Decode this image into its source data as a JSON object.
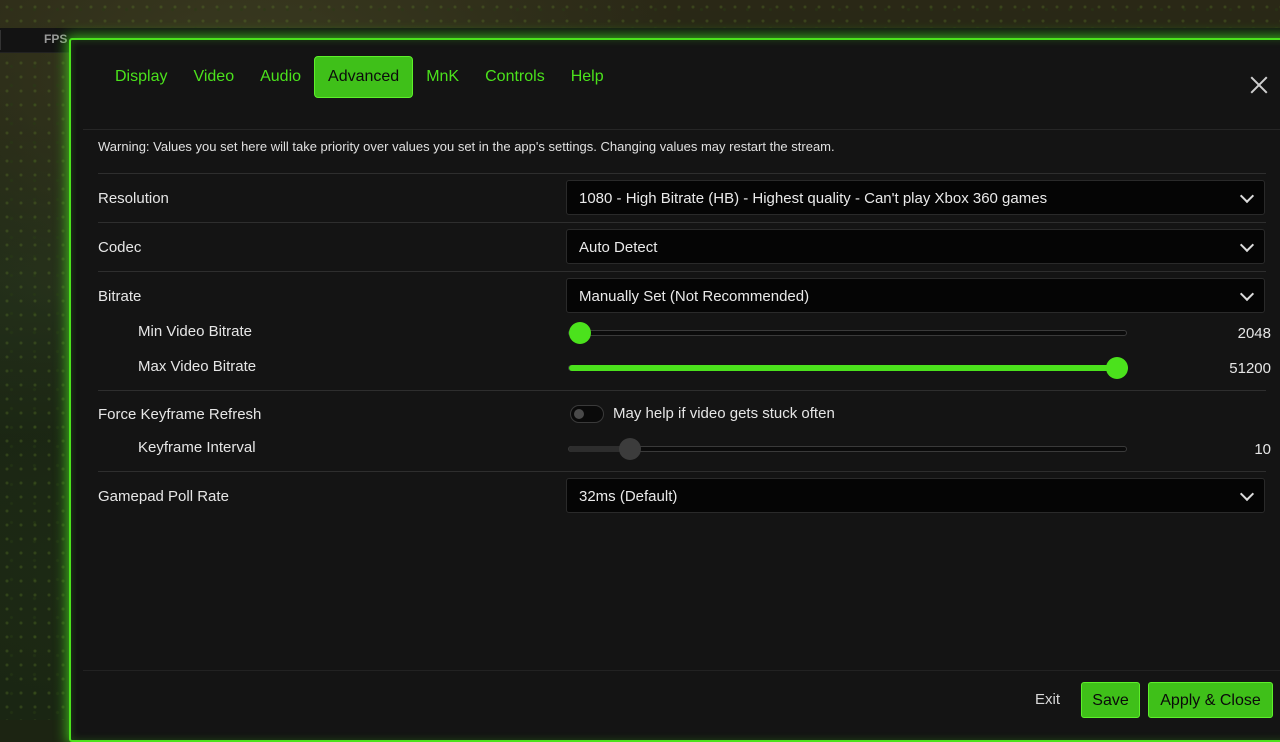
{
  "hud": {
    "fps_label": "FPS"
  },
  "tabs": [
    {
      "label": "Display"
    },
    {
      "label": "Video"
    },
    {
      "label": "Audio"
    },
    {
      "label": "Advanced",
      "active": true
    },
    {
      "label": "MnK"
    },
    {
      "label": "Controls"
    },
    {
      "label": "Help"
    }
  ],
  "warning": "Warning: Values you set here will take priority over values you set in the app's settings. Changing values may restart the stream.",
  "settings": {
    "resolution": {
      "label": "Resolution",
      "value": "1080 - High Bitrate (HB) - Highest quality - Can't play Xbox 360 games"
    },
    "codec": {
      "label": "Codec",
      "value": "Auto Detect"
    },
    "bitrate": {
      "label": "Bitrate",
      "value": "Manually Set (Not Recommended)"
    },
    "min_bitrate": {
      "label": "Min Video Bitrate",
      "value": "2048",
      "level": 0.02
    },
    "max_bitrate": {
      "label": "Max Video Bitrate",
      "value": "51200",
      "level": 1.0
    },
    "force_keyframe": {
      "label": "Force Keyframe Refresh",
      "hint": "May help if video gets stuck often",
      "enabled": false
    },
    "keyframe_interval": {
      "label": "Keyframe Interval",
      "value": "10",
      "level": 0.11
    },
    "gamepad_poll": {
      "label": "Gamepad Poll Rate",
      "value": "32ms (Default)"
    }
  },
  "footer": {
    "exit": "Exit",
    "save": "Save",
    "apply": "Apply & Close"
  },
  "colors": {
    "accent": "#4be21c",
    "panel": "#141414"
  },
  "icons": {
    "close": "close-icon",
    "dropdown": "chevron-down-icon"
  }
}
